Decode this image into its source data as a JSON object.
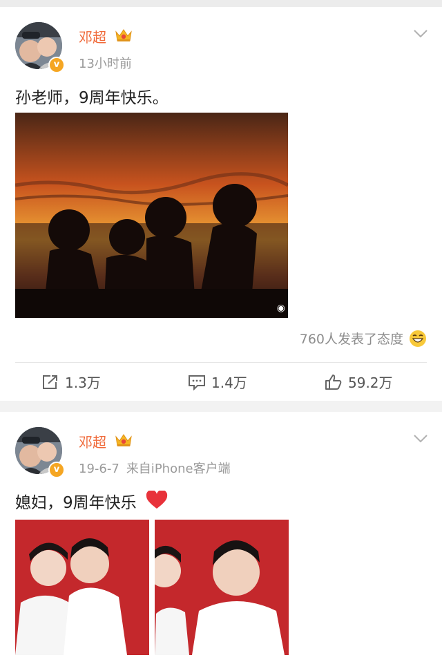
{
  "posts": [
    {
      "username": "邓超",
      "time": "13小时前",
      "text": "孙老师，9周年快乐。",
      "attitude": "760人发表了态度",
      "actions": {
        "share": "1.3万",
        "comment": "1.4万",
        "like": "59.2万"
      }
    },
    {
      "username": "邓超",
      "time": "19-6-7",
      "source": "来自iPhone客户端",
      "text": "媳妇，9周年快乐"
    }
  ],
  "colors": {
    "username": "#f06a3a",
    "badge": "#f5a623",
    "heart": "#e8323a"
  },
  "icons": [
    "crown-icon",
    "verified-badge-icon",
    "chevron-down-icon",
    "share-icon",
    "comment-icon",
    "like-icon",
    "laugh-emoji-icon",
    "heart-icon"
  ]
}
